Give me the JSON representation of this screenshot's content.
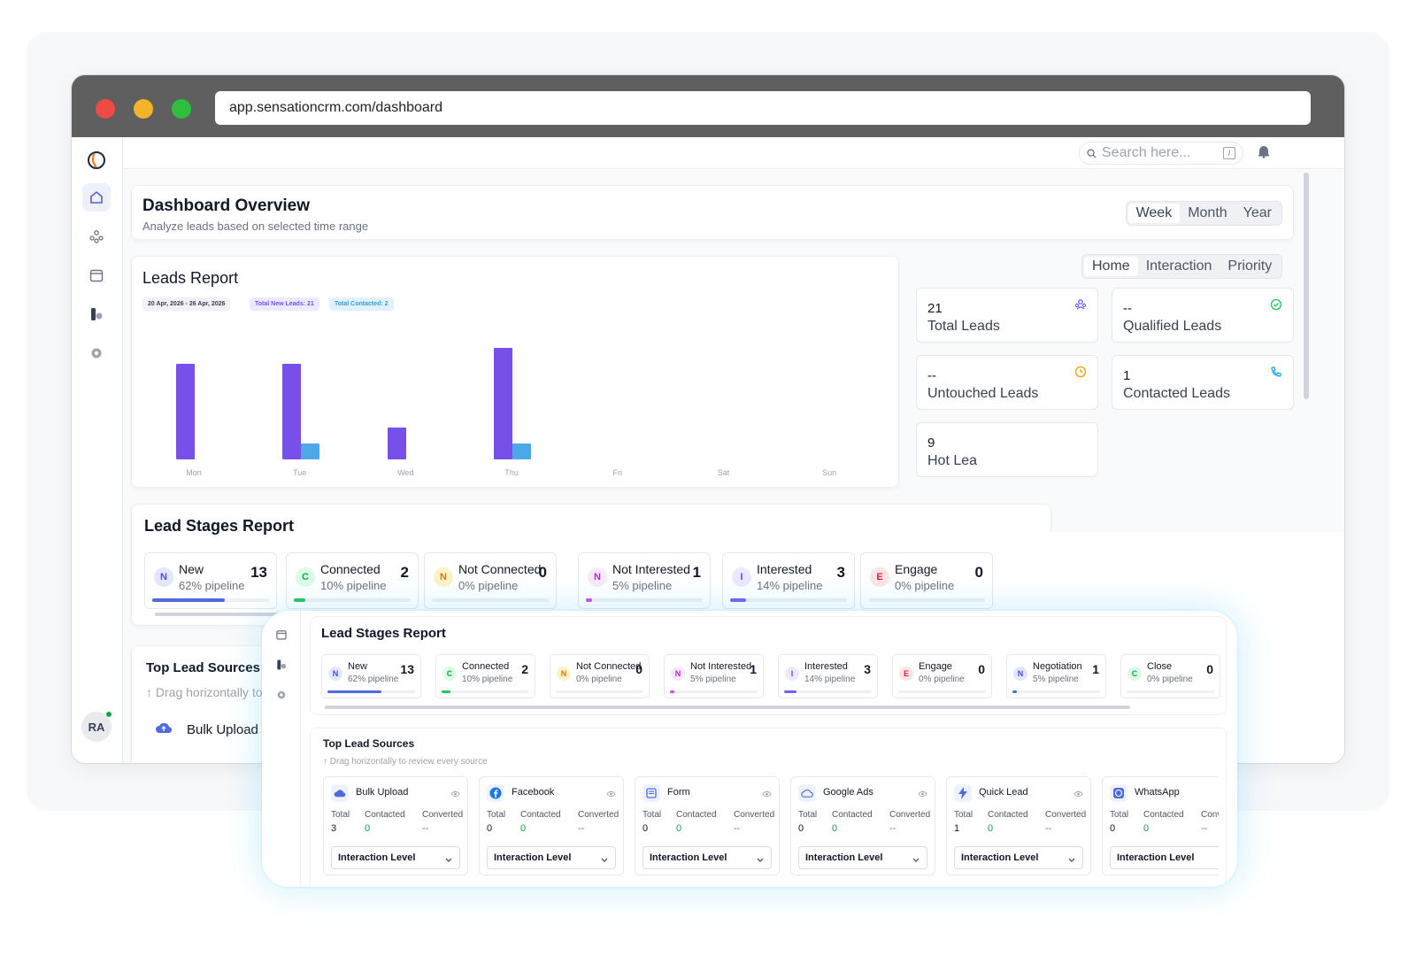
{
  "browser": {
    "url": "app.sensationcrm.com/dashboard"
  },
  "colors": {
    "accent": "#7650e8",
    "contacted": "#4ca8e9",
    "brand_blue": "#4f6bde"
  },
  "topbar": {
    "search_placeholder": "Search here...",
    "kbd": "/"
  },
  "user": {
    "initials": "RA"
  },
  "overview": {
    "title": "Dashboard Overview",
    "subtitle": "Analyze leads based on selected time range",
    "ranges": [
      "Week",
      "Month",
      "Year"
    ]
  },
  "leads_report": {
    "title": "Leads Report",
    "chips": [
      "20 Apr, 2026 - 26 Apr, 2026",
      "Total New Leads: 21",
      "Total Contacted: 2"
    ]
  },
  "chart_data": {
    "type": "bar",
    "categories": [
      "Mon",
      "Tue",
      "Wed",
      "Thu",
      "Fri",
      "Sat",
      "Sun"
    ],
    "series": [
      {
        "values": [
          6,
          6,
          2,
          7,
          0,
          0,
          0
        ]
      },
      {
        "values": [
          0,
          1,
          0,
          1,
          0,
          0,
          0
        ]
      }
    ],
    "ylim": [
      0,
      7
    ],
    "grid": false
  },
  "stat_tabs": [
    "Home",
    "Interaction",
    "Priority"
  ],
  "stats": [
    {
      "value": "21",
      "label": "Total Leads"
    },
    {
      "value": "--",
      "label": "Qualified Leads"
    },
    {
      "value": "--",
      "label": "Untouched Leads"
    },
    {
      "value": "1",
      "label": "Contacted Leads"
    },
    {
      "value": "9",
      "label": "Hot Lea"
    }
  ],
  "stages": {
    "title": "Lead Stages Report",
    "items": [
      {
        "letter": "N",
        "name": "New",
        "pct": "62% pipeline",
        "count": "13",
        "progress": 0.62
      },
      {
        "letter": "C",
        "name": "Connected",
        "pct": "10% pipeline",
        "count": "2",
        "progress": 0.1
      },
      {
        "letter": "N",
        "name": "Not Connected",
        "pct": "0% pipeline",
        "count": "0",
        "progress": 0
      },
      {
        "letter": "N",
        "name": "Not Interested",
        "pct": "5% pipeline",
        "count": "1",
        "progress": 0.05
      },
      {
        "letter": "I",
        "name": "Interested",
        "pct": "14% pipeline",
        "count": "3",
        "progress": 0.14
      },
      {
        "letter": "E",
        "name": "Engage",
        "pct": "0% pipeline",
        "count": "0",
        "progress": 0
      },
      {
        "letter": "N",
        "name": "Negotiation",
        "pct": "5% pipeline",
        "count": "1",
        "progress": 0.05
      },
      {
        "letter": "C",
        "name": "Close",
        "pct": "0% pipeline",
        "count": "0",
        "progress": 0
      }
    ]
  },
  "sources": {
    "title": "Top Lead Sources",
    "hint": "Drag horizontally to review every source",
    "hint_cut": "Drag horizontally to",
    "col_total": "Total",
    "col_contacted": "Contacted",
    "col_converted": "Converted",
    "dropdown": "Interaction Level",
    "items": [
      {
        "name": "Bulk Upload",
        "total": "3",
        "contacted": "0",
        "converted": "--"
      },
      {
        "name": "Facebook",
        "total": "0",
        "contacted": "0",
        "converted": "--"
      },
      {
        "name": "Form",
        "total": "0",
        "contacted": "0",
        "converted": "--"
      },
      {
        "name": "Google Ads",
        "total": "0",
        "contacted": "0",
        "converted": "--"
      },
      {
        "name": "Quick Lead",
        "total": "1",
        "contacted": "0",
        "converted": "--"
      },
      {
        "name": "WhatsApp",
        "total": "0",
        "contacted": "0",
        "converted": "--"
      }
    ]
  }
}
